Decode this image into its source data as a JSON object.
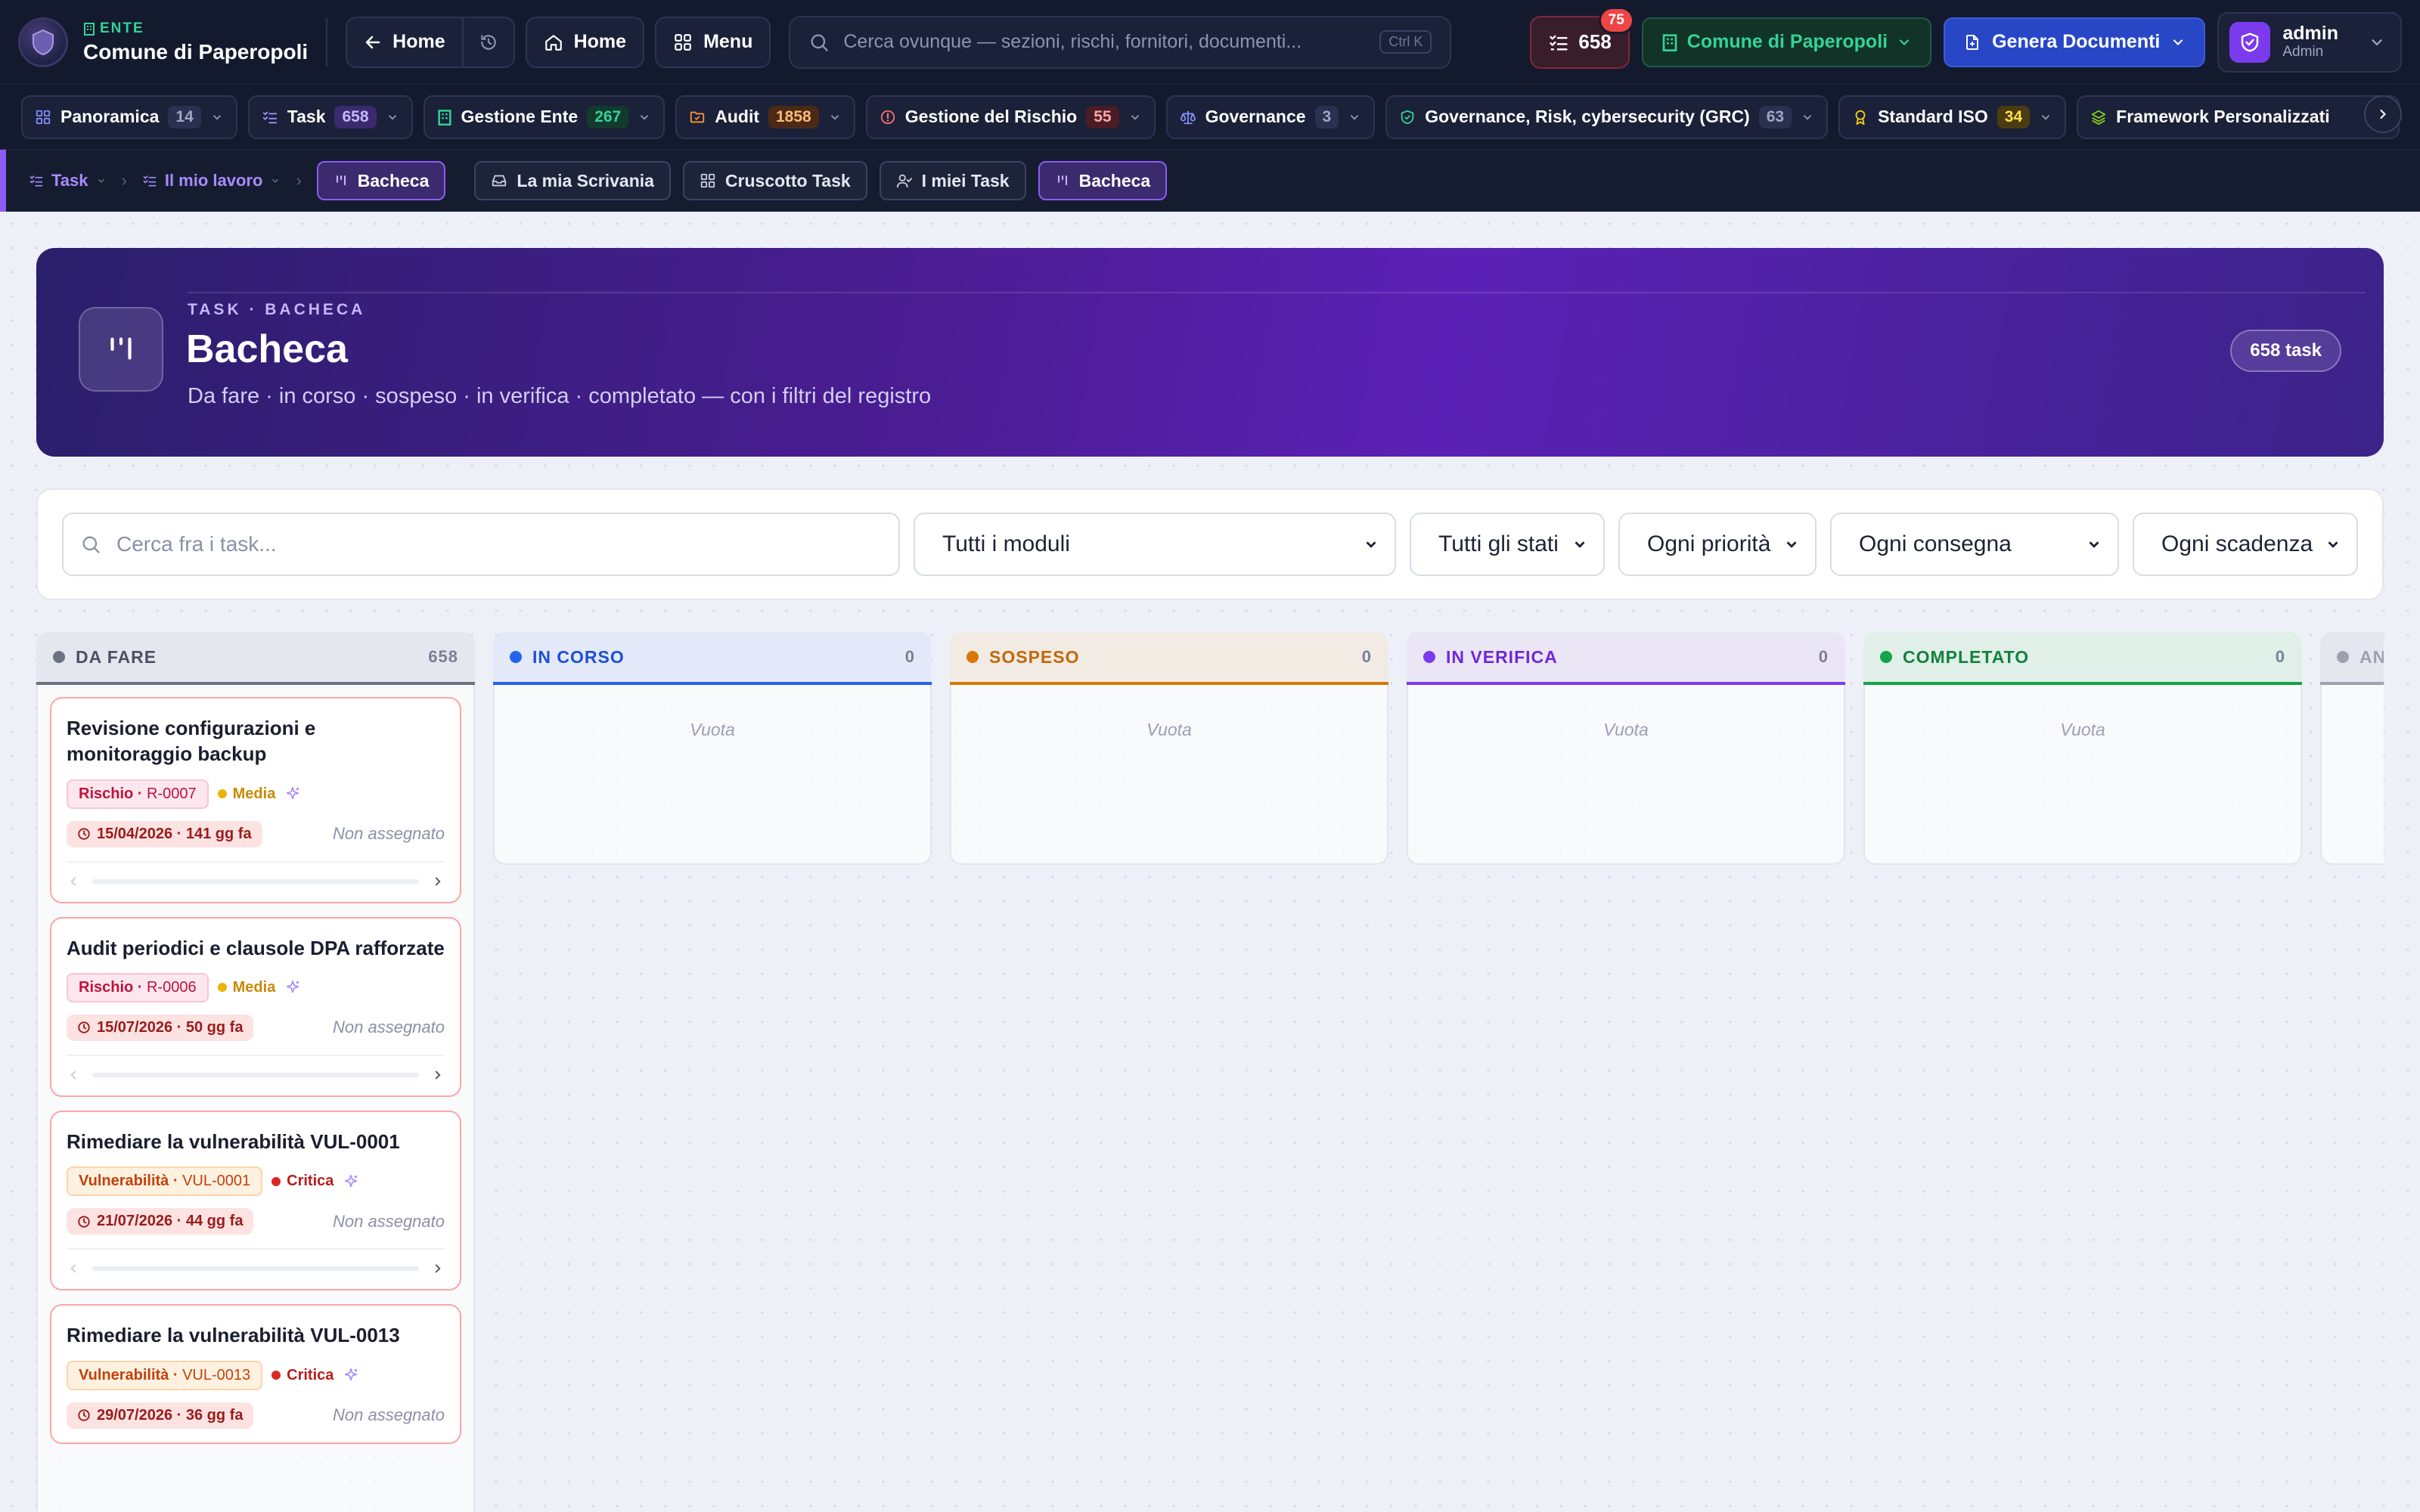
{
  "topbar": {
    "ente_tag": "ENTE",
    "ente_name": "Comune di Paperopoli",
    "back_label": "Home",
    "home_label": "Home",
    "menu_label": "Menu",
    "search_placeholder": "Cerca ovunque — sezioni, rischi, fornitori, documenti...",
    "search_shortcut": "Ctrl K",
    "tasks_count": "658",
    "tasks_badge": "75",
    "org_label": "Comune di Paperopoli",
    "generate_label": "Genera Documenti",
    "user_name": "admin",
    "user_role": "Admin"
  },
  "modules": [
    {
      "label": "Panoramica",
      "count": "14",
      "icon": "grid-icon",
      "color": "#8d94b0"
    },
    {
      "label": "Task",
      "count": "658",
      "icon": "list-check-icon",
      "color": "#a78bfa"
    },
    {
      "label": "Gestione Ente",
      "count": "267",
      "icon": "building-icon",
      "color": "#34d399"
    },
    {
      "label": "Audit",
      "count": "1858",
      "icon": "folder-icon",
      "color": "#fb923c"
    },
    {
      "label": "Gestione del Rischio",
      "count": "55",
      "icon": "alert-icon",
      "color": "#f87171"
    },
    {
      "label": "Governance",
      "count": "3",
      "icon": "scale-icon",
      "color": "#8d94b0"
    },
    {
      "label": "Governance, Risk, cybersecurity (GRC)",
      "count": "63",
      "icon": "shield-icon",
      "color": "#8d94b0"
    },
    {
      "label": "Standard ISO",
      "count": "34",
      "icon": "award-icon",
      "color": "#facc15"
    },
    {
      "label": "Framework Personalizzati",
      "count": "",
      "icon": "layers-icon",
      "color": "#8d94b0"
    }
  ],
  "breadcrumb": {
    "level1": "Task",
    "level2": "Il mio lavoro",
    "current": "Bacheca",
    "tabs": [
      {
        "label": "La mia Scrivania",
        "icon": "inbox-icon"
      },
      {
        "label": "Cruscotto Task",
        "icon": "dashboard-icon"
      },
      {
        "label": "I miei Task",
        "icon": "user-check-icon"
      },
      {
        "label": "Bacheca",
        "icon": "kanban-icon"
      }
    ]
  },
  "hero": {
    "kicker": "TASK · BACHECA",
    "title": "Bacheca",
    "subtitle": "Da fare · in corso · sospeso · in verifica · completato — con i filtri del registro",
    "count_pill": "658 task"
  },
  "filters": {
    "search_placeholder": "Cerca fra i task...",
    "module": "Tutti i moduli",
    "status": "Tutti gli stati",
    "priority": "Ogni priorità",
    "delivery": "Ogni consegna",
    "deadline": "Ogni scadenza"
  },
  "columns": [
    {
      "title": "DA FARE",
      "count": "658",
      "color": "#6b7280",
      "bg": "#e5e7ee",
      "empty": ""
    },
    {
      "title": "IN CORSO",
      "count": "0",
      "color": "#2563eb",
      "bg": "#e3e9f8",
      "empty": "Vuota"
    },
    {
      "title": "SOSPESO",
      "count": "0",
      "color": "#d97706",
      "bg": "#f1ebe4",
      "empty": "Vuota"
    },
    {
      "title": "IN VERIFICA",
      "count": "0",
      "color": "#7c3aed",
      "bg": "#ebe6f6",
      "empty": "Vuota"
    },
    {
      "title": "COMPLETATO",
      "count": "0",
      "color": "#16a34a",
      "bg": "#e0efe8",
      "empty": "Vuota"
    },
    {
      "title": "AN",
      "count": "",
      "color": "#9ca3af",
      "bg": "#e5e7ee",
      "empty": ""
    }
  ],
  "cards": [
    {
      "title": "Revisione configurazioni e monitoraggio backup",
      "tag_type": "Rischio",
      "tag_id": "R-0007",
      "priority": "Media",
      "due": "15/04/2026 · 141 gg fa",
      "assignee": "Non assegnato"
    },
    {
      "title": "Audit periodici e clausole DPA rafforzate",
      "tag_type": "Rischio",
      "tag_id": "R-0006",
      "priority": "Media",
      "due": "15/07/2026 · 50 gg fa",
      "assignee": "Non assegnato"
    },
    {
      "title": "Rimediare la vulnerabilità VUL-0001",
      "tag_type": "Vulnerabilità",
      "tag_id": "VUL-0001",
      "priority": "Critica",
      "due": "21/07/2026 · 44 gg fa",
      "assignee": "Non assegnato"
    },
    {
      "title": "Rimediare la vulnerabilità VUL-0013",
      "tag_type": "Vulnerabilità",
      "tag_id": "VUL-0013",
      "priority": "Critica",
      "due": "29/07/2026 · 36 gg fa",
      "assignee": "Non assegnato"
    }
  ],
  "colors": {
    "accent": "#7c3aed",
    "priority_media": "#eab308",
    "priority_critica": "#dc2626",
    "tag_rischio_bg": "#fde7ee",
    "tag_rischio_fg": "#be123c",
    "tag_vuln_bg": "#fff1e0",
    "tag_vuln_fg": "#c2410c"
  }
}
